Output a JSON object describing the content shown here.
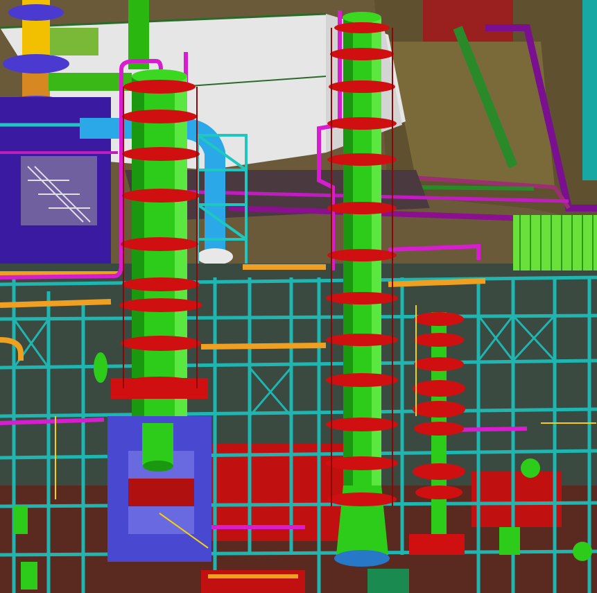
{
  "scene": {
    "subject": "3d-plant-model-render",
    "colors": {
      "ground": "#6b5a3a",
      "roof": "#e8e8e8",
      "steel": "#1fb5b0",
      "steel_dark": "#0f8f8a",
      "vessel": "#2ecc1a",
      "vessel_dark": "#1a9910",
      "platform": "#d01010",
      "platform_dark": "#8a0808",
      "pipe_magenta": "#d81cd0",
      "pipe_orange": "#f0a020",
      "pipe_blue": "#2aa8e8",
      "pipe_yellow": "#f5d010",
      "support_blue": "#4a4ad8",
      "floor_red": "#b01010",
      "purple": "#6a10b0",
      "olive": "#5a5030"
    }
  }
}
